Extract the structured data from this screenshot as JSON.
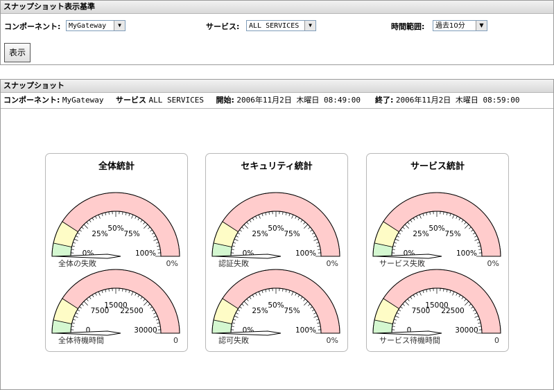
{
  "criteria": {
    "title": "スナップショット表示基準",
    "component_label": "コンポーネント:",
    "component_value": "MyGateway",
    "service_label": "サービス:",
    "service_value": "ALL SERVICES",
    "time_label": "時間範囲:",
    "time_value": "過去10分",
    "display_button": "表示"
  },
  "snapshot": {
    "title": "スナップショット",
    "component_label": "コンポーネント:",
    "component_value": "MyGateway",
    "service_label": "サービス",
    "service_value": "ALL SERVICES",
    "start_label": "開始:",
    "start_value": "2006年11月2日 木曜日 08:49:00",
    "end_label": "終了:",
    "end_value": "2006年11月2日 木曜日 08:59:00"
  },
  "cards": [
    {
      "title": "全体統計",
      "gauges": [
        {
          "label": "全体の失敗",
          "value_text": "0%",
          "ticks": [
            "0%",
            "25%",
            "50%",
            "75%",
            "100%"
          ]
        },
        {
          "label": "全体待機時間",
          "value_text": "0",
          "ticks": [
            "0",
            "7500",
            "15000",
            "22500",
            "30000"
          ]
        }
      ]
    },
    {
      "title": "セキュリティ統計",
      "gauges": [
        {
          "label": "認証失敗",
          "value_text": "0%",
          "ticks": [
            "0%",
            "25%",
            "50%",
            "75%",
            "100%"
          ]
        },
        {
          "label": "認可失敗",
          "value_text": "0%",
          "ticks": [
            "0%",
            "25%",
            "50%",
            "75%",
            "100%"
          ]
        }
      ]
    },
    {
      "title": "サービス統計",
      "gauges": [
        {
          "label": "サービス失敗",
          "value_text": "0%",
          "ticks": [
            "0%",
            "25%",
            "50%",
            "75%",
            "100%"
          ]
        },
        {
          "label": "サービス待機時間",
          "value_text": "0",
          "ticks": [
            "0",
            "7500",
            "15000",
            "22500",
            "30000"
          ]
        }
      ]
    }
  ],
  "colors": {
    "green_zone": "#d4f7d0",
    "yellow_zone": "#fefcc6",
    "red_zone": "#ffcccc"
  }
}
